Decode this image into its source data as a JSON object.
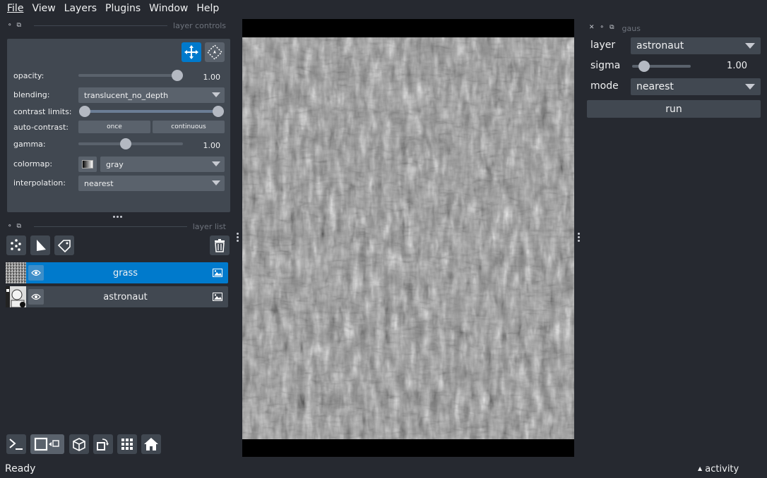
{
  "menu": [
    "File",
    "View",
    "Layers",
    "Plugins",
    "Window",
    "Help"
  ],
  "layer_controls": {
    "title": "layer controls",
    "opacity_label": "opacity:",
    "opacity_value": "1.00",
    "opacity_level": 1.0,
    "blending_label": "blending:",
    "blending_value": "translucent_no_depth",
    "contrast_label": "contrast limits:",
    "auto_contrast_label": "auto-contrast:",
    "once_label": "once",
    "continuous_label": "continuous",
    "gamma_label": "gamma:",
    "gamma_value": "1.00",
    "colormap_label": "colormap:",
    "colormap_value": "gray",
    "interpolation_label": "interpolation:",
    "interpolation_value": "nearest"
  },
  "layer_list": {
    "title": "layer list",
    "layers": [
      {
        "name": "grass",
        "selected": true
      },
      {
        "name": "astronaut",
        "selected": false
      }
    ]
  },
  "plugin": {
    "title": "gaus",
    "layer_label": "layer",
    "layer_value": "astronaut",
    "sigma_label": "sigma",
    "sigma_value": "1.00",
    "mode_label": "mode",
    "mode_value": "nearest",
    "run_label": "run"
  },
  "status": {
    "text": "Ready",
    "activity": "activity"
  },
  "colors": {
    "background": "#262930",
    "panel": "#414851",
    "accent": "#007acc"
  }
}
